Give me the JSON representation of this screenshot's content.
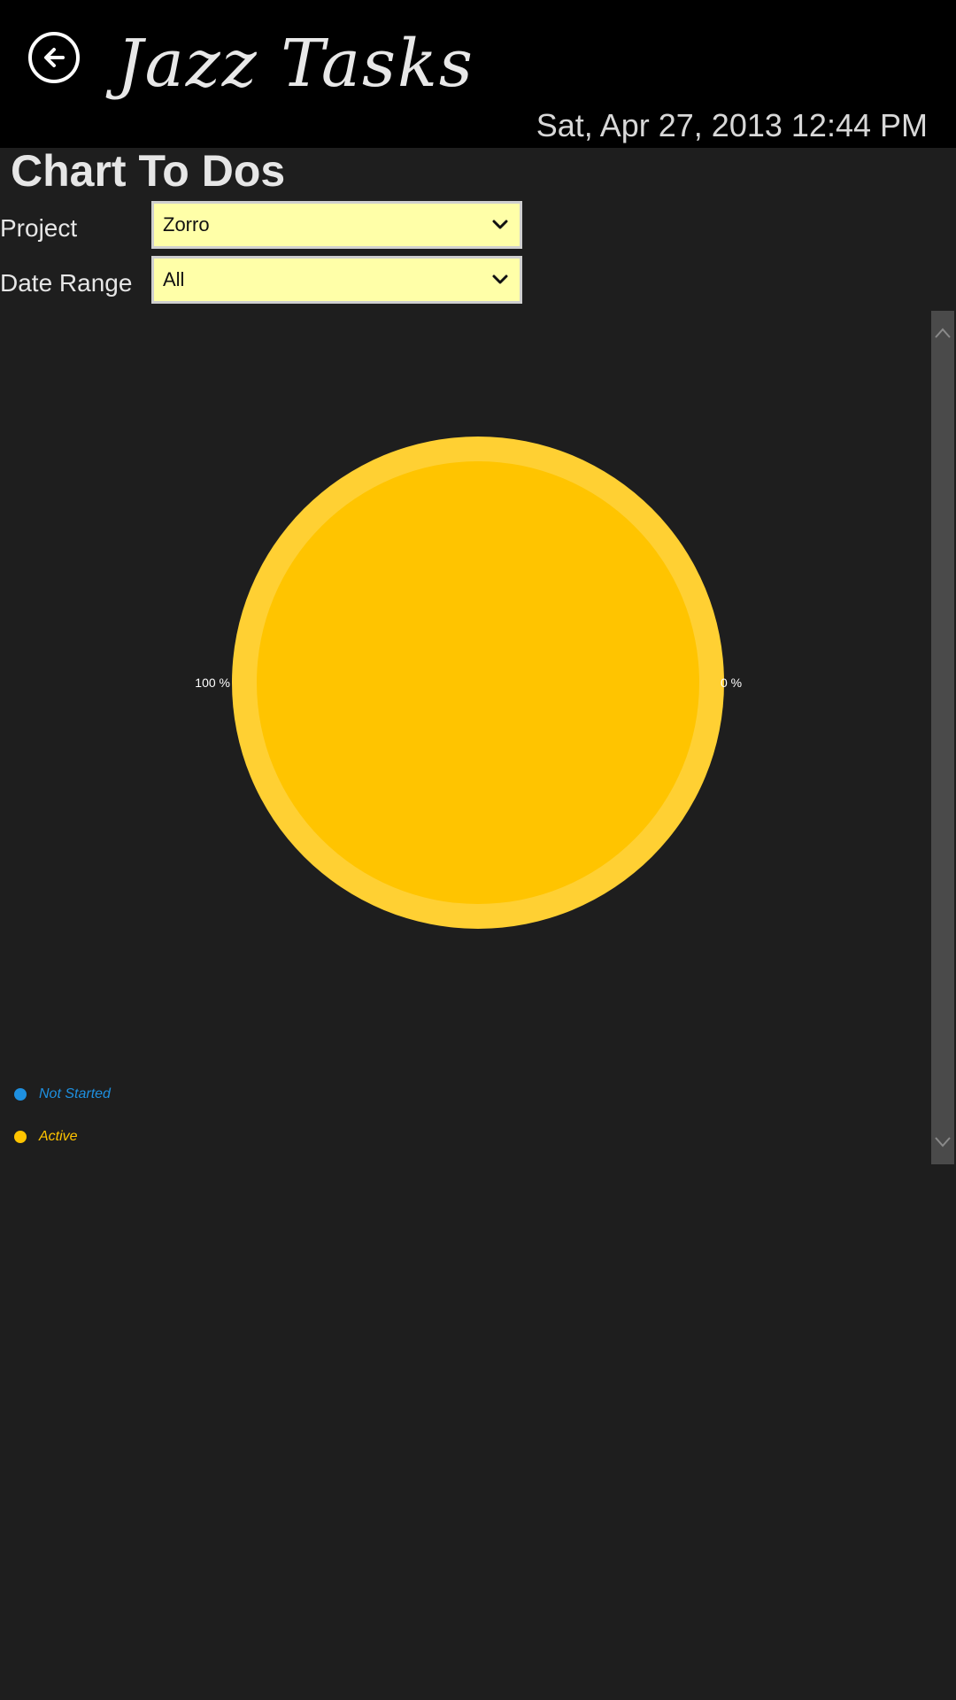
{
  "app": {
    "title": "Jazz Tasks",
    "datetime": "Sat, Apr 27, 2013  12:44 PM"
  },
  "page": {
    "title": "Chart To Dos"
  },
  "filters": {
    "project_label": "Project",
    "project_value": "Zorro",
    "date_range_label": "Date Range",
    "date_range_value": "All"
  },
  "icons": {
    "back": "back-arrow-icon",
    "dropdown": "chevron-down-icon",
    "scroll_up": "chevron-up-icon",
    "scroll_down": "chevron-down-icon"
  },
  "colors": {
    "active": "#ffc400",
    "active_ring": "#ffd033",
    "not_started": "#1e90e0",
    "select_bg": "#ffffa8"
  },
  "chart_data": {
    "type": "pie",
    "series": [
      {
        "name": "Not Started",
        "value": 0,
        "label": "0 %",
        "color": "#1e90e0"
      },
      {
        "name": "Active",
        "value": 100,
        "label": "100 %",
        "color": "#ffc400"
      }
    ],
    "legend": [
      "Not Started",
      "Active"
    ],
    "legend_position": "bottom-left"
  }
}
